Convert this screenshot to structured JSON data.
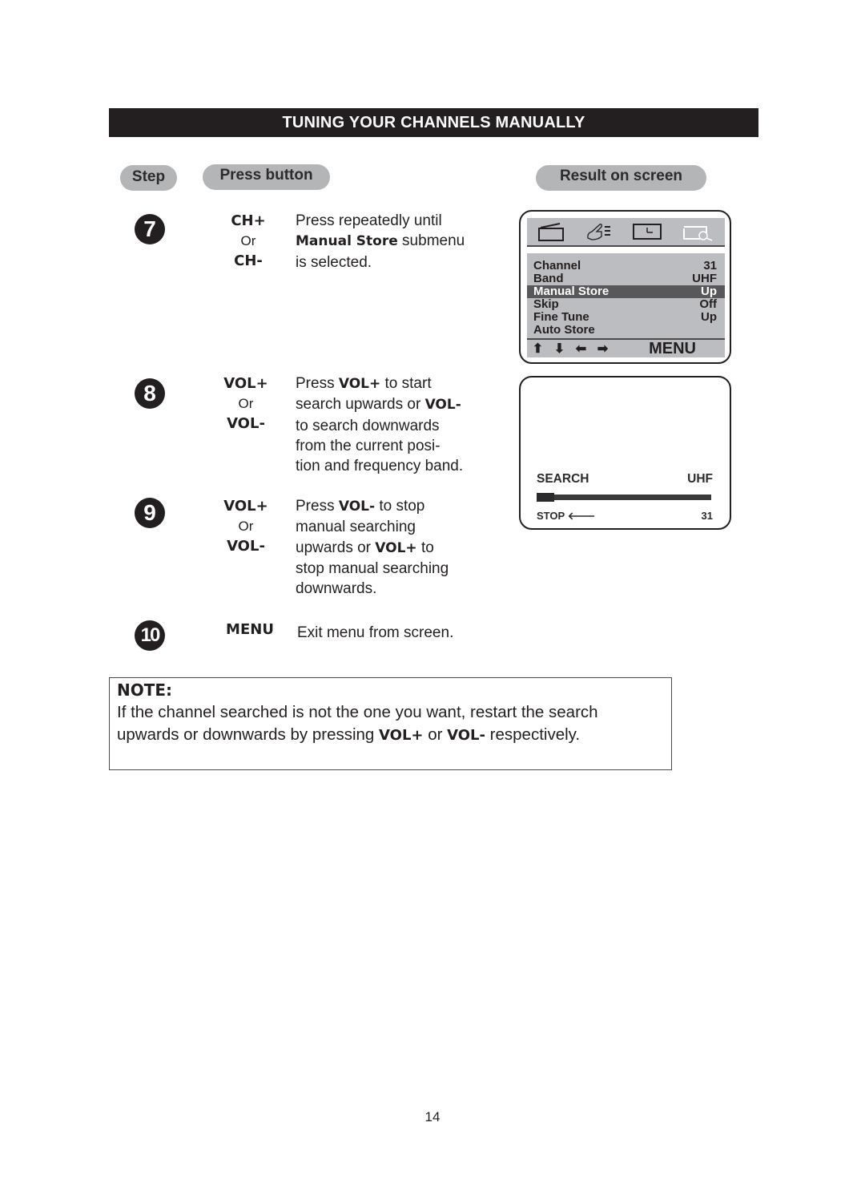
{
  "section_title": "TUNING YOUR CHANNELS MANUALLY",
  "headers": {
    "step": "Step",
    "press_button": "Press button",
    "result": "Result on screen"
  },
  "steps": [
    {
      "number": "7",
      "buttons": [
        "CH+",
        "Or",
        "CH-"
      ],
      "description": [
        {
          "t": "Press repeatedly until"
        },
        {
          "b": "Manual Store",
          "t": " submenu"
        },
        {
          "t": "is selected."
        }
      ]
    },
    {
      "number": "8",
      "buttons": [
        "VOL+",
        "Or",
        "VOL-"
      ],
      "description": [
        {
          "t": "Press ",
          "b": "VOL+",
          "t2": " to start"
        },
        {
          "t": "search upwards or ",
          "b": "VOL-"
        },
        {
          "t": "to search downwards"
        },
        {
          "t": "from the current posi-"
        },
        {
          "t": "tion and frequency band."
        }
      ]
    },
    {
      "number": "9",
      "buttons": [
        "VOL+",
        "Or",
        "VOL-"
      ],
      "description": [
        {
          "t": "Press ",
          "b": "VOL-",
          "t2": " to stop"
        },
        {
          "t": "manual searching"
        },
        {
          "t": "upwards or ",
          "b": "VOL+",
          "t2": " to"
        },
        {
          "t": "stop manual searching"
        },
        {
          "t": "downwards."
        }
      ]
    },
    {
      "number": "10",
      "buttons": [
        "MENU"
      ],
      "description": [
        {
          "t": "Exit menu from screen."
        }
      ]
    }
  ],
  "screen1": {
    "icons": [
      "tv-icon",
      "hand-pointer-icon",
      "clock-icon",
      "search-picture-icon"
    ],
    "menu": [
      {
        "label": "Channel",
        "value": "31"
      },
      {
        "label": "Band",
        "value": "UHF"
      },
      {
        "label": "Manual Store",
        "value": "Up",
        "selected": true
      },
      {
        "label": "Skip",
        "value": "Off"
      },
      {
        "label": "Fine Tune",
        "value": "Up"
      },
      {
        "label": "Auto Store",
        "value": ""
      }
    ],
    "nav_arrows": [
      "⬆",
      "⬇",
      "⬅",
      "➡"
    ],
    "menu_label": "MENU"
  },
  "screen2": {
    "search_label": "SEARCH",
    "band": "UHF",
    "progress_percent": 10,
    "stop_label": "STOP",
    "channel": "31"
  },
  "note": {
    "title": "NOTE:",
    "line1": "If the channel searched is not the one you want, restart the search",
    "line2_pre": "upwards or downwards by pressing ",
    "line2_b1": "VOL+",
    "line2_mid": " or ",
    "line2_b2": "VOL-",
    "line2_post": " respectively."
  },
  "page_number": "14"
}
